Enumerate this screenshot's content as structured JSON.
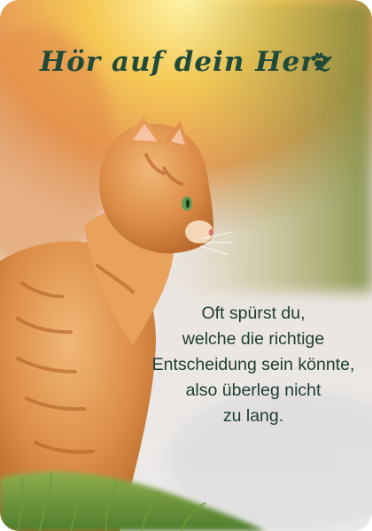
{
  "card": {
    "title": "Hör auf dein Herz",
    "title_icon": "paw-icon",
    "quote_lines": [
      "Oft spürst du,",
      "welche die richtige",
      "Entscheidung sein könnte,",
      "also überleg nicht",
      "zu lang."
    ]
  },
  "colors": {
    "text": "#1d3d31",
    "title": "#1f4a3a",
    "fur": "#d9904a",
    "sun": "#f6c64a"
  }
}
